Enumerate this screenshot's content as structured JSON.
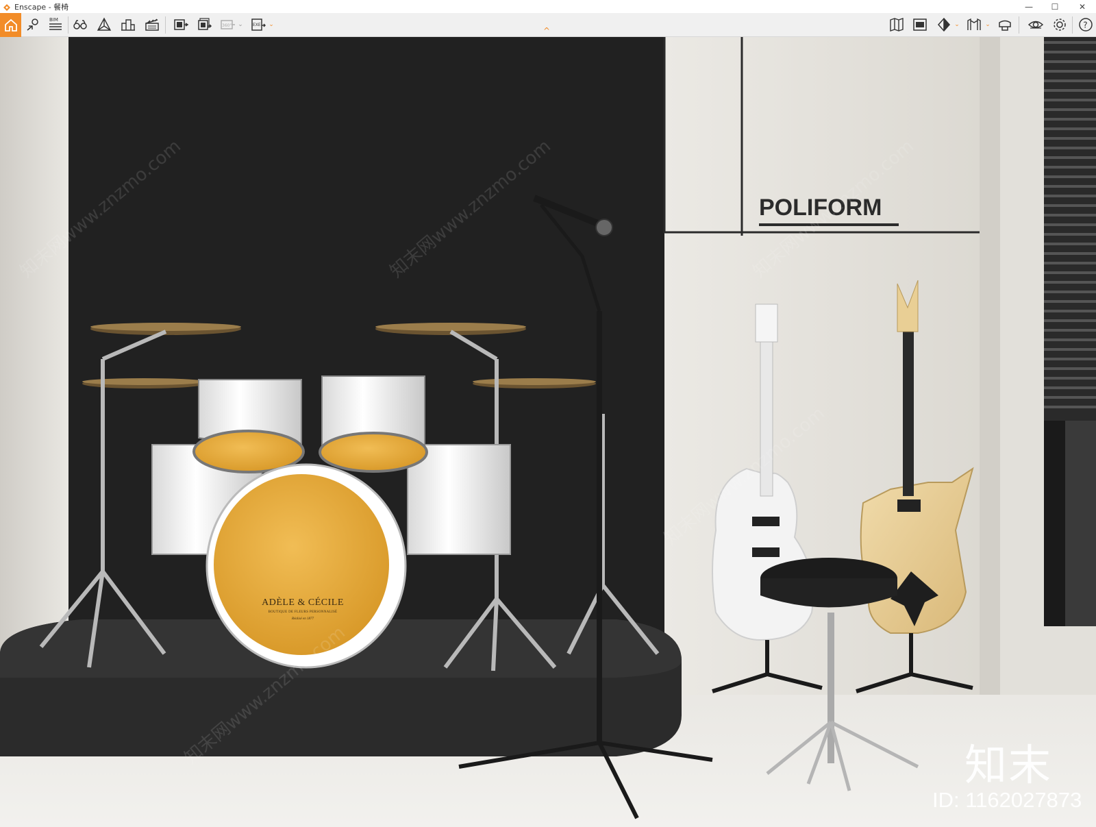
{
  "window": {
    "title": "Enscape - 餐椅",
    "controls": {
      "minimize": "—",
      "maximize": "☐",
      "close": "✕"
    }
  },
  "toolbar": {
    "left_icons": [
      "home-icon",
      "location-pin-icon",
      "bim-icon",
      "binoculars-icon",
      "perspective-icon",
      "buildings-icon",
      "clapperboard-icon",
      "screenshot-export-icon",
      "batch-export-icon",
      "panorama-360-icon",
      "exe-export-icon"
    ],
    "bim_label": "BIM",
    "pano_label": "360°",
    "exe_label": "EXE",
    "right_icons": [
      "map-icon",
      "view-icon",
      "sun-icon",
      "assets-icon",
      "vr-headset-icon",
      "visibility-icon",
      "settings-icon",
      "help-icon"
    ]
  },
  "scene": {
    "brand_sign": "POLIFORM",
    "drum_logo": {
      "name": "ADÈLE & CÉCILE",
      "tagline": "BOUTIQUE DE FLEURS PERSONNALISÉ",
      "since": "Réalisé en 1877"
    },
    "watermark": {
      "logo_text": "知末",
      "id_text": "ID: 1162027873",
      "diagonal_text": "知末网www.znzmo.com"
    }
  },
  "colors": {
    "accent": "#f28c28",
    "wall_dark": "#1e1e1e",
    "wall_light": "#e8e6e1",
    "stage": "#2a2a2a",
    "drum_head": "#e8a83a"
  }
}
